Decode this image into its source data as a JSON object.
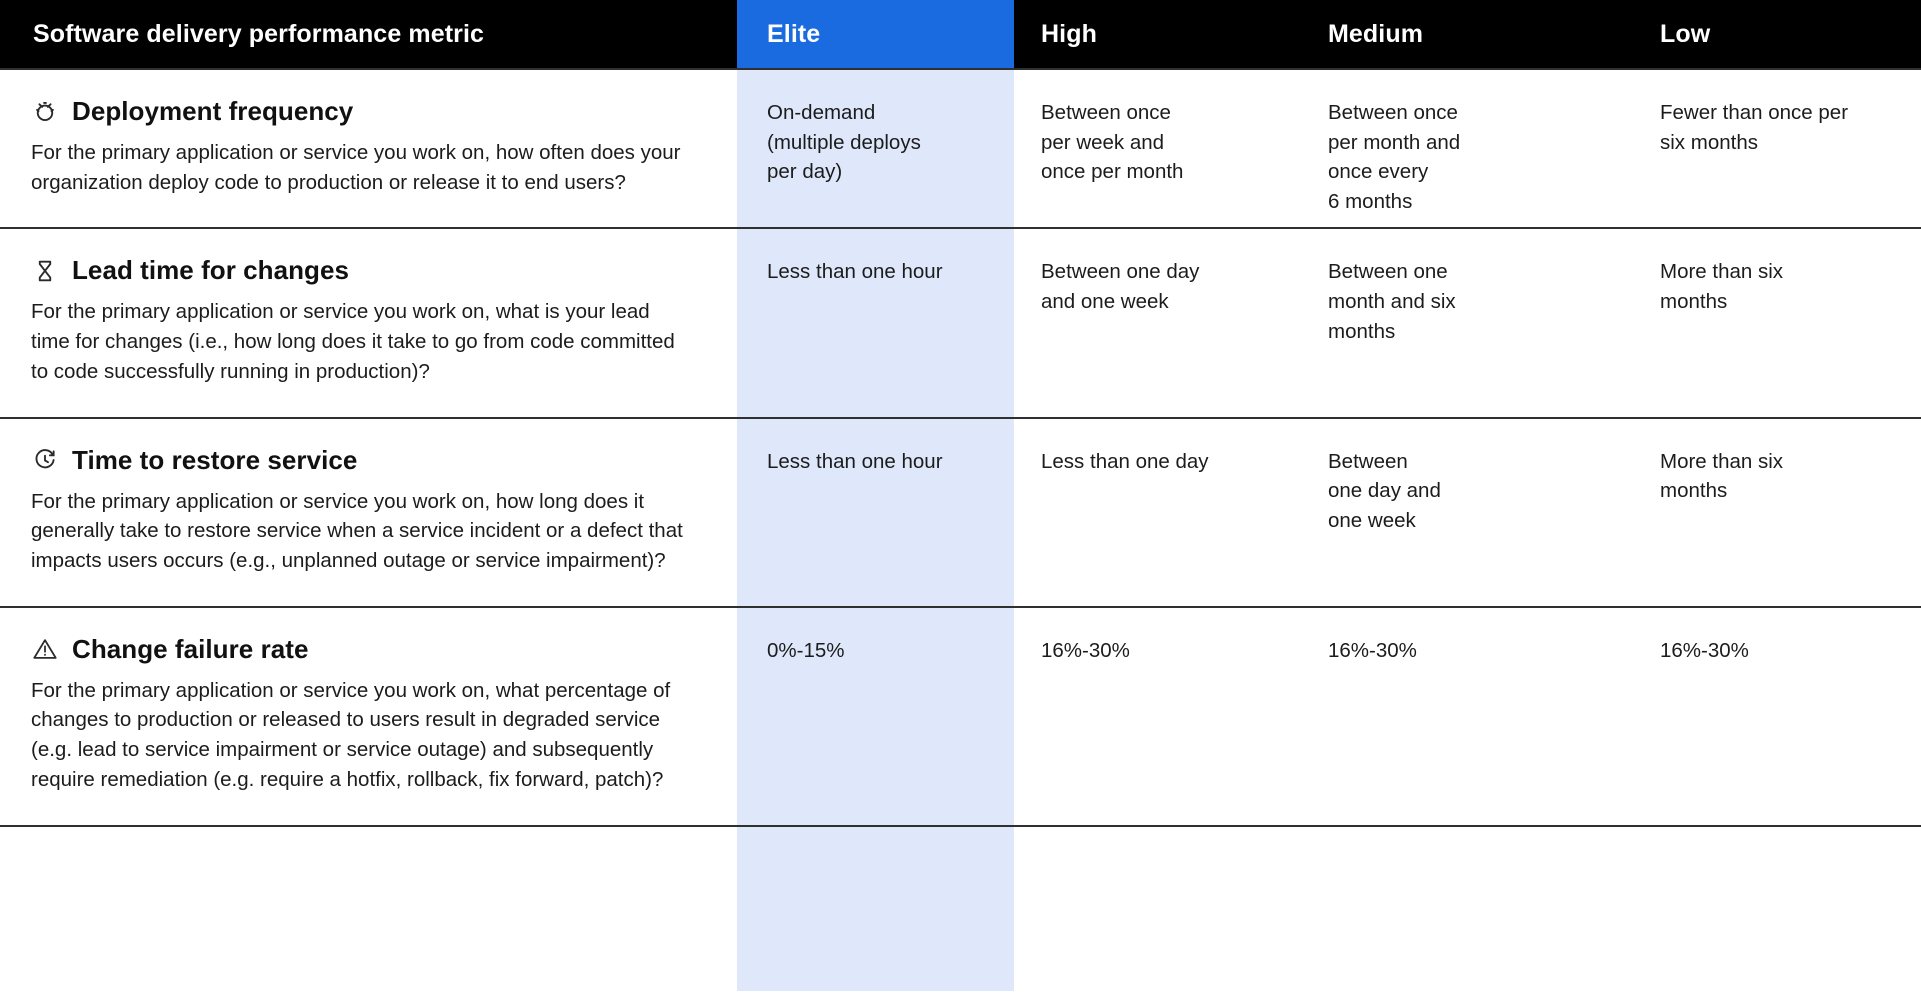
{
  "table": {
    "columns": [
      {
        "key": "metric",
        "label": "Software delivery performance metric"
      },
      {
        "key": "elite",
        "label": "Elite"
      },
      {
        "key": "high",
        "label": "High"
      },
      {
        "key": "medium",
        "label": "Medium"
      },
      {
        "key": "low",
        "label": "Low"
      }
    ],
    "colors": {
      "header_background": "#000000",
      "header_text": "#ffffff",
      "elite_header_background": "#1a6ae0",
      "elite_column_highlight": "#dfe8fb",
      "row_divider": "#303030",
      "body_text": "#1c1c1c"
    },
    "rows": [
      {
        "icon": "deployment-frequency-icon",
        "title": "Deployment frequency",
        "description": "For the primary application or service you work on, how often does your organization deploy code to production or release it to end users?",
        "elite": [
          "On-demand",
          "(multiple deploys",
          "per day)"
        ],
        "high": [
          "Between once",
          "per week and",
          "once per month"
        ],
        "medium": [
          "Between once",
          "per month and",
          "once every",
          "6 months"
        ],
        "low": [
          "Fewer than once per",
          "six months"
        ]
      },
      {
        "icon": "lead-time-hourglass-icon",
        "title": "Lead time for changes",
        "description": "For the primary application or service you work on, what is your lead time for changes (i.e., how long does it take to go from code committed to code successfully running in production)?",
        "elite": [
          "Less than one hour"
        ],
        "high": [
          "Between one day",
          "and one week"
        ],
        "medium": [
          "Between one",
          "month and six",
          "months"
        ],
        "low": [
          "More than six",
          "months"
        ]
      },
      {
        "icon": "time-to-restore-icon",
        "title": "Time to restore service",
        "description": "For the primary application or service you work on, how long does it generally take to restore service when a service incident or a defect that impacts users occurs (e.g., unplanned outage or service impairment)?",
        "elite": [
          "Less than one hour"
        ],
        "high": [
          "Less than one day"
        ],
        "medium": [
          "Between",
          "one day and",
          "one week"
        ],
        "low": [
          "More than six",
          "months"
        ]
      },
      {
        "icon": "change-failure-warning-icon",
        "title": "Change failure rate",
        "description": "For the primary application or service you work on, what percentage of changes to production or released to users result in degraded service (e.g. lead to service impairment or service outage) and subsequently require remediation (e.g. require a hotfix, rollback, fix forward, patch)?",
        "elite": [
          "0%-15%"
        ],
        "high": [
          "16%-30%"
        ],
        "medium": [
          "16%-30%"
        ],
        "low": [
          "16%-30%"
        ]
      }
    ]
  }
}
